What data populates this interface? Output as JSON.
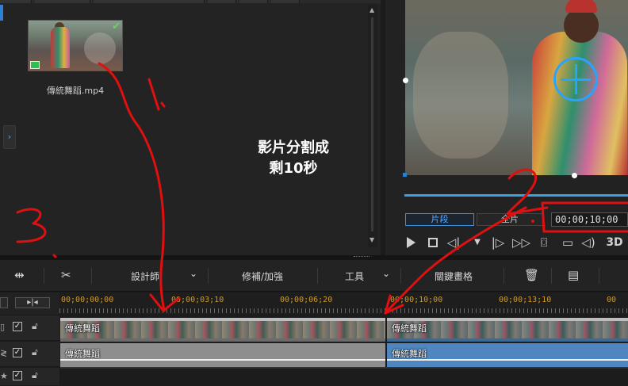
{
  "library": {
    "thumbnail_label": "傳統舞蹈.mp4",
    "check_icon": "checkmark-icon",
    "film_icon": "film-icon"
  },
  "annotation": {
    "line1": "影片分割成",
    "line2": "剩10秒",
    "marks": [
      "1.",
      "2",
      "3."
    ],
    "color": "#e01010"
  },
  "preview": {
    "clip_button": "片段",
    "full_button": "全片",
    "timecode": "00;00;10;00",
    "controls": {
      "play": "play-icon",
      "stop": "stop-icon",
      "prev_frame": "previous-frame-icon",
      "split": "split-marker-icon",
      "next_frame": "next-frame-icon",
      "fast_forward": "fast-forward-icon",
      "snapshot": "camera-icon",
      "subtitles": "subtitle-icon",
      "volume": "volume-icon",
      "mode_3d": "3D"
    }
  },
  "toolbar": {
    "designer": "設計師",
    "enhance": "修補/加強",
    "tools": "工具",
    "keyframes": "關鍵畫格"
  },
  "ruler": {
    "times": [
      "00;00;00;00",
      "00;00;03;10",
      "00;00;06;20",
      "00;00;10;00",
      "00;00;13;10",
      "00"
    ]
  },
  "tracks": {
    "video_clip_a": "傳統舞蹈",
    "video_clip_b": "傳統舞蹈",
    "audio_clip_a": "傳統舞蹈",
    "audio_clip_b": "傳統舞蹈"
  },
  "colors": {
    "accent": "#3aa0e6",
    "timecode_text": "#d09a2a",
    "annotation_red": "#e01010"
  }
}
